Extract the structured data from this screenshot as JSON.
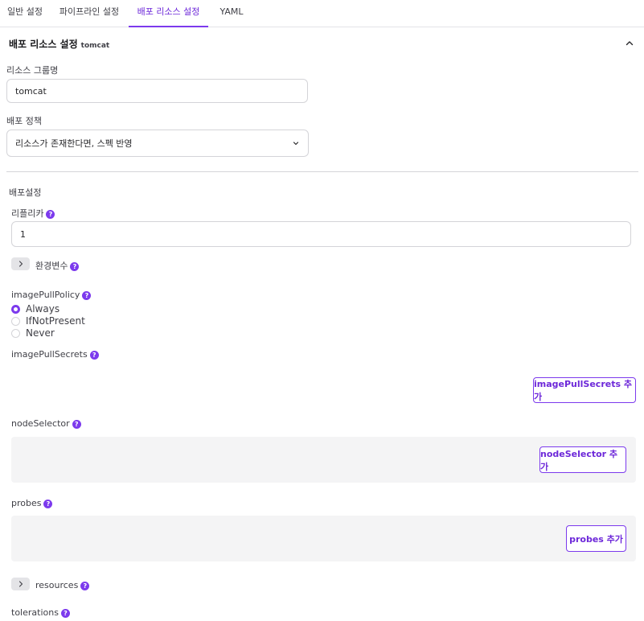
{
  "tabs": [
    {
      "label": "일반 설정"
    },
    {
      "label": "파이프라인 설정"
    },
    {
      "label": "배포 리소스 설정"
    },
    {
      "label": "YAML"
    }
  ],
  "section": {
    "title": "배포 리소스 설정",
    "subtitle": "tomcat"
  },
  "resource_group": {
    "label": "리소스 그룹명",
    "value": "tomcat"
  },
  "deploy_policy": {
    "label": "배포 정책",
    "value": "리소스가 존재한다면, 스펙 반영"
  },
  "deploy_settings": {
    "label": "배포설정"
  },
  "replicas": {
    "label": "리플리카",
    "value": "1"
  },
  "env": {
    "label": "환경변수"
  },
  "image_pull_policy": {
    "label": "imagePullPolicy",
    "options": [
      "Always",
      "IfNotPresent",
      "Never"
    ],
    "selected": "Always"
  },
  "image_pull_secrets": {
    "label": "imagePullSecrets",
    "add_label": "imagePullSecrets 추가"
  },
  "node_selector": {
    "label": "nodeSelector",
    "add_label": "nodeSelector 추가"
  },
  "probes": {
    "label": "probes",
    "add_label": "probes 추가"
  },
  "resources": {
    "label": "resources"
  },
  "tolerations": {
    "label": "tolerations"
  },
  "help_glyph": "?",
  "colors": {
    "accent": "#7c3aed",
    "accent_text": "#6d28d9",
    "border": "#d4d4d8",
    "panel": "#f4f4f5"
  }
}
